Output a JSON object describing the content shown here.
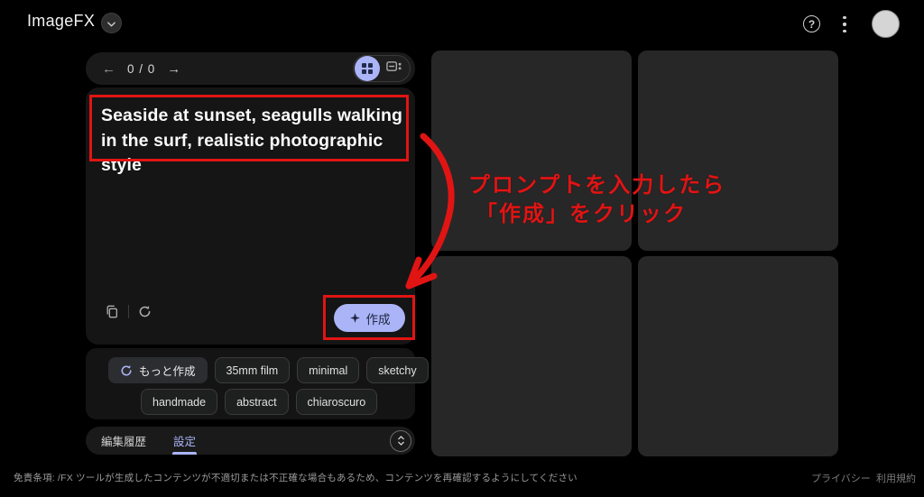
{
  "colors": {
    "accent": "#aab4f7",
    "accent_text": "#1d2440",
    "annotation_red": "#e11414",
    "page_bg": "#000000",
    "panel_bg": "#1a1a1a",
    "card_bg": "#151515",
    "tile_bg": "#272727"
  },
  "header": {
    "app_title": "ImageFX",
    "help_glyph": "?"
  },
  "left_panel": {
    "nav": {
      "prev_glyph": "←",
      "counter": "0 / 0",
      "next_glyph": "→"
    },
    "prompt_text": "Seaside at sunset, seagulls walking in the surf, realistic photographic style",
    "create_button_label": "作成",
    "chips_row1": [
      {
        "label": "もっと作成",
        "icon": "refresh-icon"
      },
      {
        "label": "35mm film"
      },
      {
        "label": "minimal"
      },
      {
        "label": "sketchy"
      }
    ],
    "chips_row2": [
      {
        "label": "handmade"
      },
      {
        "label": "abstract"
      },
      {
        "label": "chiaroscuro"
      }
    ],
    "bottom_tabs": {
      "history_label": "編集履歴",
      "settings_label": "設定"
    }
  },
  "annotation": {
    "line1": "プロンプトを入力したら",
    "line2": "「作成」をクリック"
  },
  "footer": {
    "disclaimer": "免責条項: /FX ツールが生成したコンテンツが不適切または不正確な場合もあるため、コンテンツを再確認するようにしてください",
    "privacy_label": "プライバシー",
    "terms_label": "利用規約"
  }
}
